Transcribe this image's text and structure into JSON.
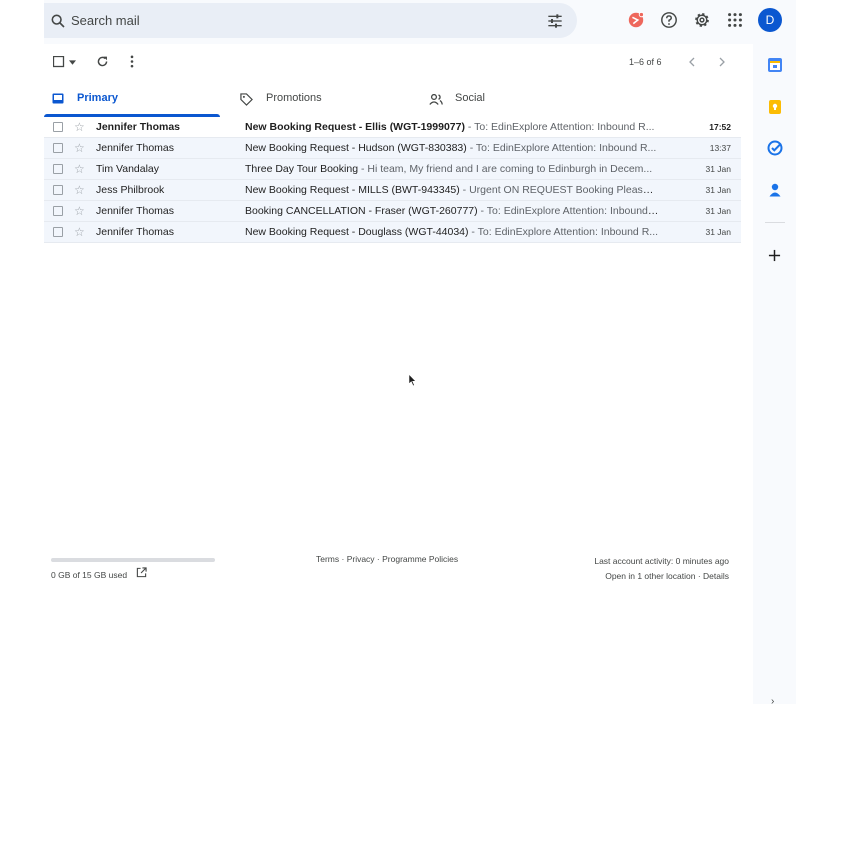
{
  "search": {
    "placeholder": "Search mail"
  },
  "account": {
    "initial": "D",
    "color": "#0b57d0"
  },
  "toolbar": {
    "page_info": "1–6 of 6"
  },
  "tabs": [
    {
      "label": "Primary",
      "active": true
    },
    {
      "label": "Promotions",
      "active": false
    },
    {
      "label": "Social",
      "active": false
    }
  ],
  "emails": [
    {
      "sender": "Jennifer Thomas",
      "subject": "New Booking Request - Ellis (WGT-1999077)",
      "snippet": " - To: EdinExplore Attention: Inbound R...",
      "date": "17:52",
      "unread": true
    },
    {
      "sender": "Jennifer Thomas",
      "subject": "New Booking Request - Hudson (WGT-830383)",
      "snippet": " - To: EdinExplore Attention: Inbound R...",
      "date": "13:37",
      "unread": false
    },
    {
      "sender": "Tim Vandalay",
      "subject": "Three Day Tour Booking",
      "snippet": " - Hi team, My friend and I are coming to Edinburgh in Decem...",
      "date": "31 Jan",
      "unread": false
    },
    {
      "sender": "Jess Philbrook",
      "subject": "New Booking Request - MILLS (BWT-943345)",
      "snippet": " - Urgent ON REQUEST Booking Please c...",
      "date": "31 Jan",
      "unread": false
    },
    {
      "sender": "Jennifer Thomas",
      "subject": "Booking CANCELLATION - Fraser (WGT-260777)",
      "snippet": " - To: EdinExplore Attention: Inbound ...",
      "date": "31 Jan",
      "unread": false
    },
    {
      "sender": "Jennifer Thomas",
      "subject": "New Booking Request - Douglass (WGT-44034)",
      "snippet": " - To: EdinExplore Attention: Inbound R...",
      "date": "31 Jan",
      "unread": false
    }
  ],
  "footer": {
    "storage": "0 GB of 15 GB used",
    "links": "Terms · Privacy · Programme Policies",
    "last_activity": "Last account activity: 0 minutes ago",
    "other_location": "Open in 1 other location · Details"
  },
  "colors": {
    "accent": "#0b57d0",
    "read_row_bg": "#f2f6fc"
  }
}
